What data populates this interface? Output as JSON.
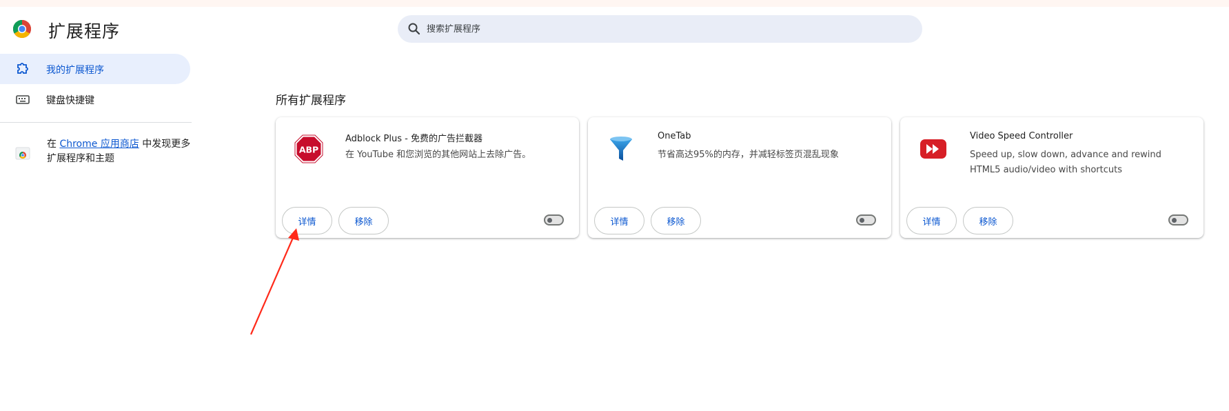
{
  "header": {
    "title": "扩展程序",
    "search_placeholder": "搜索扩展程序"
  },
  "sidebar": {
    "items": [
      {
        "label": "我的扩展程序",
        "icon": "puzzle-icon",
        "active": true
      },
      {
        "label": "键盘快捷键",
        "icon": "keyboard-icon",
        "active": false
      }
    ],
    "store_promo": {
      "prefix": "在",
      "link": "Chrome 应用商店",
      "suffix": "中发现更多扩展程序和主题"
    }
  },
  "main": {
    "section_title": "所有扩展程序",
    "extensions": [
      {
        "name": "Adblock Plus - 免费的广告拦截器",
        "description": "在 YouTube 和您浏览的其他网站上去除广告。",
        "details_label": "详情",
        "remove_label": "移除",
        "enabled": false,
        "icon": "abp-stop-icon"
      },
      {
        "name": "OneTab",
        "description": "节省高达95%的内存，并减轻标签页混乱现象",
        "details_label": "详情",
        "remove_label": "移除",
        "enabled": false,
        "icon": "funnel-icon"
      },
      {
        "name": "Video Speed Controller",
        "description": "Speed up, slow down, advance and rewind HTML5 audio/video with shortcuts",
        "details_label": "详情",
        "remove_label": "移除",
        "enabled": false,
        "icon": "fast-forward-icon"
      }
    ]
  },
  "colors": {
    "accent": "#0b57d0",
    "active_nav_bg": "#e8effd",
    "search_bg": "#e9edf7",
    "annotation_arrow": "#ff2a1a"
  }
}
